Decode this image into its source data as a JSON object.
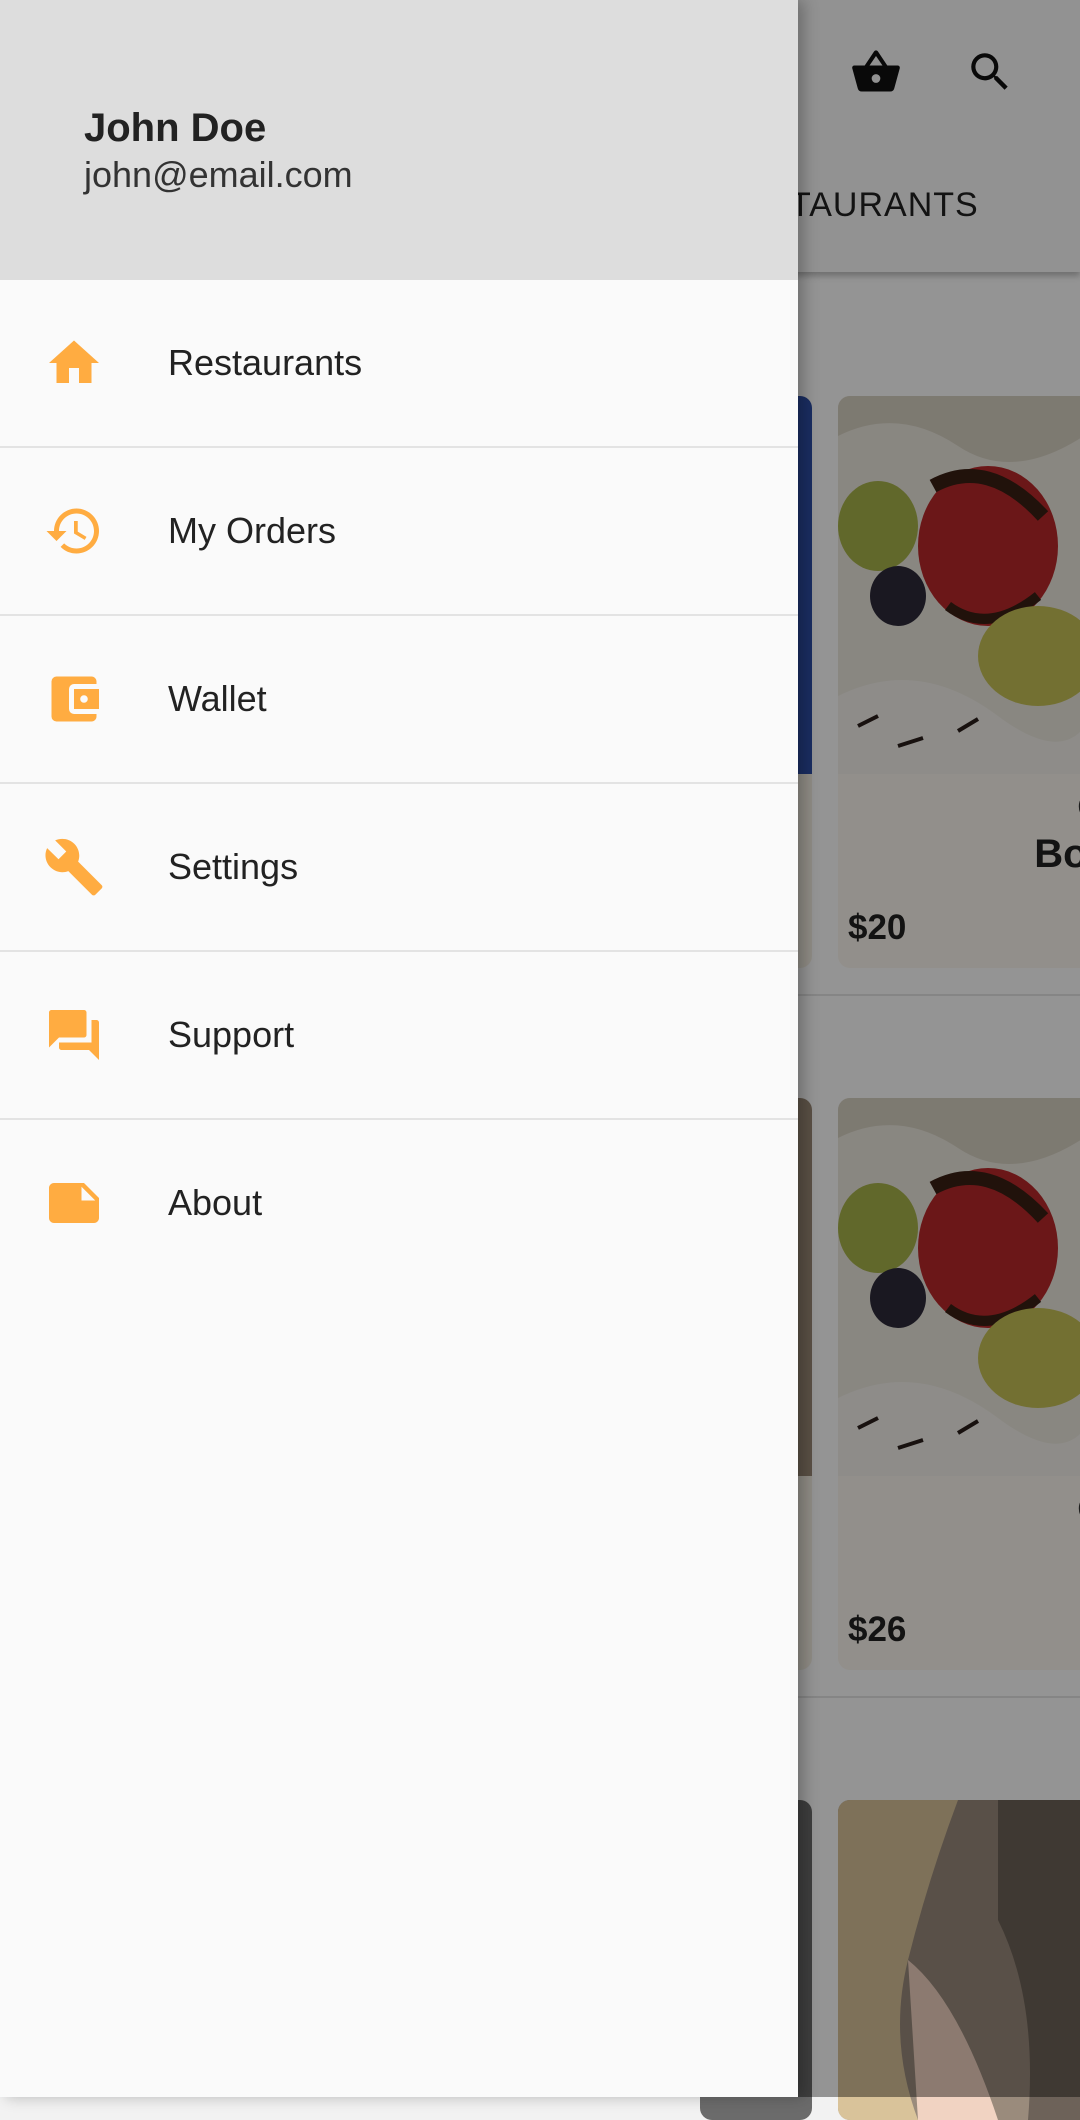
{
  "user": {
    "name": "John Doe",
    "email": "john@email.com"
  },
  "menu": {
    "items": [
      {
        "label": "Restaurants",
        "icon": "home-icon"
      },
      {
        "label": "My Orders",
        "icon": "history-icon"
      },
      {
        "label": "Wallet",
        "icon": "wallet-icon"
      },
      {
        "label": "Settings",
        "icon": "wrench-icon"
      },
      {
        "label": "Support",
        "icon": "chat-icon"
      },
      {
        "label": "About",
        "icon": "note-icon"
      }
    ]
  },
  "background": {
    "tab_label": "TAURANTS",
    "cart_icon": "basket-icon",
    "search_icon": "search-icon",
    "cards": [
      {
        "category": "Cr",
        "title": "Boo",
        "price": "$20"
      },
      {
        "category": "Cr",
        "title": "",
        "price": "$26"
      }
    ]
  },
  "colors": {
    "accent": "#ffac41",
    "drawer_header": "#dddddd",
    "drawer_background": "#fafafa"
  }
}
